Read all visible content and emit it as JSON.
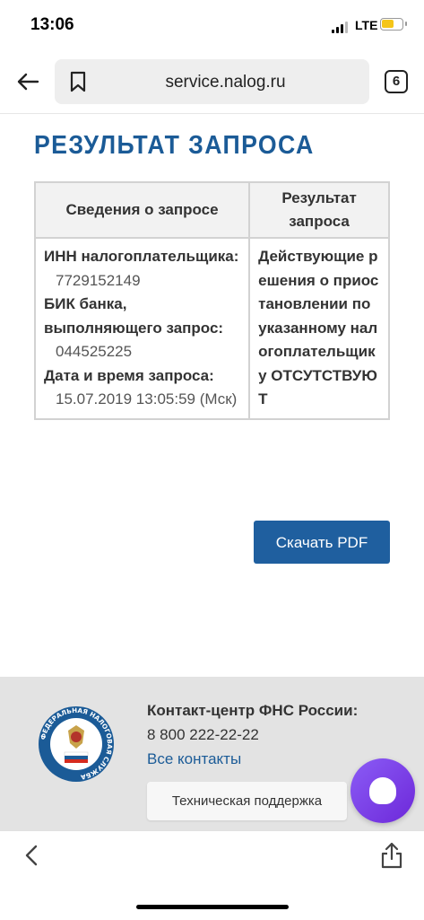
{
  "status_bar": {
    "time": "13:06",
    "network": "LTE",
    "battery_color": "#f5c518"
  },
  "browser": {
    "url": "service.nalog.ru",
    "tab_count": "6",
    "icons": [
      "back-arrow-icon",
      "bookmark-icon",
      "tabs-icon"
    ]
  },
  "page": {
    "title": "РЕЗУЛЬТАТ ЗАПРОСА",
    "title_color": "#1b5b97",
    "table": {
      "headers": [
        "Сведения о запросе",
        "Результат запроса"
      ],
      "info": {
        "inn_label": "ИНН налогоплательщика:",
        "inn_value": "7729152149",
        "bik_label": "БИК банка, выполняющего запрос:",
        "bik_value": "044525225",
        "date_label": "Дата и время запроса:",
        "date_value": "15.07.2019 13:05:59 (Мск)"
      },
      "result": "Действующие решения о приостановлении по указанному налогоплательщику ОТСУТСТВУЮТ"
    },
    "download_button": "Скачать PDF",
    "button_color": "#1f5f9f"
  },
  "footer": {
    "emblem_text": "ФЕДЕРАЛЬНАЯ НАЛОГОВАЯ СЛУЖБА",
    "contact_title": "Контакт-центр ФНС России:",
    "phone": "8 800 222-22-22",
    "all_contacts_link": "Все контакты",
    "support_button": "Техническая поддержка"
  },
  "bottom_bar": {
    "icons": [
      "chevron-left-icon",
      "share-icon"
    ]
  }
}
